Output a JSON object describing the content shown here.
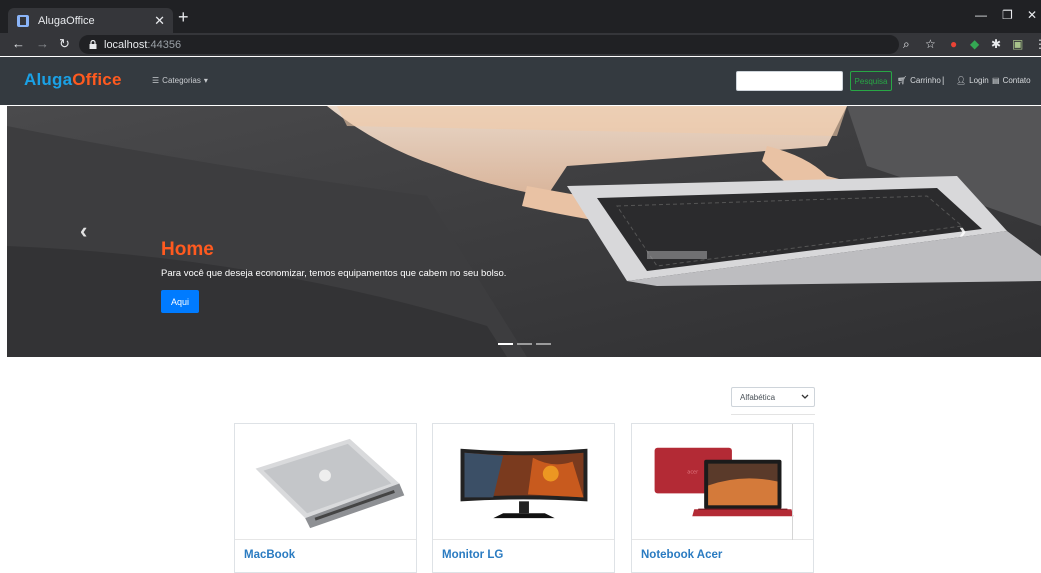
{
  "browser": {
    "tab_title": "AlugaOffice",
    "url_host": "localhost",
    "url_port": ":44356",
    "icons": [
      "back-icon",
      "forward-icon",
      "reload-icon",
      "lock-icon",
      "zoom-icon",
      "star-icon",
      "extension-icon",
      "puzzle-icon",
      "profile-icon",
      "menu-icon"
    ]
  },
  "navbar": {
    "brand_part1": "Aluga",
    "brand_part2": "Office",
    "categories_label": "Categorias",
    "search_button": "Pesquisa",
    "cart_label": "Carrinho",
    "separator": "|",
    "login_label": "Login",
    "contact_label": "Contato",
    "colors": {
      "brand_blue": "#1aa1e6",
      "brand_orange": "#ff5a1f",
      "bg": "#343a40",
      "search_green": "#28a745"
    }
  },
  "carousel": {
    "title": "Home",
    "text": "Para você que deseja economizar, temos equipamentos que cabem no seu bolso.",
    "button": "Aqui",
    "prev_icon": "‹",
    "next_icon": "›",
    "slides_count": 3,
    "active_slide": 1
  },
  "sort": {
    "selected": "Alfabética"
  },
  "products": [
    {
      "name": "MacBook",
      "image": "laptop-silver-image"
    },
    {
      "name": "Monitor LG",
      "image": "monitor-image"
    },
    {
      "name": "Notebook Acer",
      "image": "red-laptop-image"
    }
  ]
}
